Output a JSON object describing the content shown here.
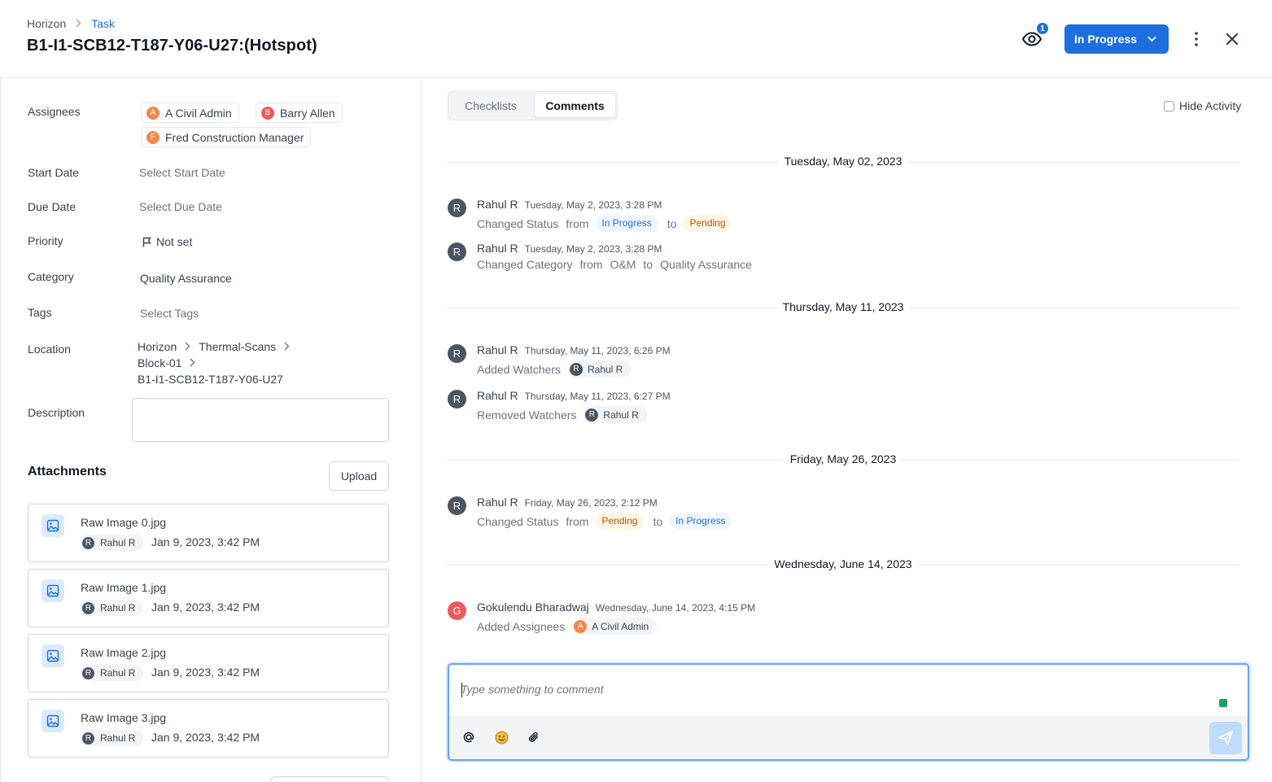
{
  "header": {
    "breadcrumb_root": "Horizon",
    "breadcrumb_current": "Task",
    "title": "B1-I1-SCB12-T187-Y06-U27:(Hotspot)",
    "watchers_count": "1",
    "status_label": "In Progress"
  },
  "details": {
    "assignees_label": "Assignees",
    "assignees": [
      {
        "initial": "A",
        "name": "A Civil Admin"
      },
      {
        "initial": "B",
        "name": "Barry Allen"
      },
      {
        "initial": "F",
        "name": "Fred Construction Manager"
      }
    ],
    "start_date_label": "Start Date",
    "start_date_placeholder": "Select Start Date",
    "due_date_label": "Due Date",
    "due_date_placeholder": "Select Due Date",
    "priority_label": "Priority",
    "priority_value": "Not set",
    "category_label": "Category",
    "category_value": "Quality Assurance",
    "tags_label": "Tags",
    "tags_placeholder": "Select Tags",
    "location_label": "Location",
    "location_path": [
      "Horizon",
      "Thermal-Scans",
      "Block-01",
      "B1-I1-SCB12-T187-Y06-U27"
    ],
    "description_label": "Description"
  },
  "attachments": {
    "title": "Attachments",
    "upload_label": "Upload",
    "items": [
      {
        "name": "Raw Image 0.jpg",
        "user_initial": "R",
        "user": "Rahul R",
        "date": "Jan 9, 2023, 3:42 PM"
      },
      {
        "name": "Raw Image 1.jpg",
        "user_initial": "R",
        "user": "Rahul R",
        "date": "Jan 9, 2023, 3:42 PM"
      },
      {
        "name": "Raw Image 2.jpg",
        "user_initial": "R",
        "user": "Rahul R",
        "date": "Jan 9, 2023, 3:42 PM"
      },
      {
        "name": "Raw Image 3.jpg",
        "user_initial": "R",
        "user": "Rahul R",
        "date": "Jan 9, 2023, 3:42 PM"
      }
    ]
  },
  "tabs": {
    "checklists": "Checklists",
    "comments": "Comments",
    "hide_activity": "Hide Activity"
  },
  "activity": {
    "day1": "Tuesday, May 02, 2023",
    "a1": {
      "initial": "R",
      "user": "Rahul R",
      "time": "Tuesday, May 2, 2023, 3:28 PM",
      "action": "Changed Status",
      "from_word": "from",
      "from": "In Progress",
      "to_word": "to",
      "to": "Pending"
    },
    "a2": {
      "initial": "R",
      "user": "Rahul R",
      "time": "Tuesday, May 2, 2023, 3:28 PM",
      "action": "Changed Category",
      "from_word": "from",
      "from": "O&M",
      "to_word": "to",
      "to": "Quality Assurance"
    },
    "day2": "Thursday, May 11, 2023",
    "a3": {
      "initial": "R",
      "user": "Rahul R",
      "time": "Thursday, May 11, 2023, 6:26 PM",
      "action": "Added Watchers",
      "target_initial": "R",
      "target": "Rahul R"
    },
    "a4": {
      "initial": "R",
      "user": "Rahul R",
      "time": "Thursday, May 11, 2023, 6:27 PM",
      "action": "Removed Watchers",
      "target_initial": "R",
      "target": "Rahul R"
    },
    "day3": "Friday, May 26, 2023",
    "a5": {
      "initial": "R",
      "user": "Rahul R",
      "time": "Friday, May 26, 2023, 2:12 PM",
      "action": "Changed Status",
      "from_word": "from",
      "from": "Pending",
      "to_word": "to",
      "to": "In Progress"
    },
    "day4": "Wednesday, June 14, 2023",
    "a6": {
      "initial": "G",
      "user": "Gokulendu Bharadwaj",
      "time": "Wednesday, June 14, 2023, 4:15 PM",
      "action": "Added Assignees",
      "target_initial": "A",
      "target": "A Civil Admin"
    }
  },
  "composer": {
    "placeholder": "Type something to comment"
  },
  "colors": {
    "accent": "#1d6fe0",
    "pending": "#b45309",
    "avatar_orange": "#f08a4b",
    "avatar_red": "#ef5a5a",
    "avatar_gray": "#4b5563"
  },
  "icons": {
    "watch": "eye-icon",
    "status": "chevron-down-icon",
    "more": "kebab-icon",
    "close": "close-icon",
    "priority": "flag-icon",
    "attachment": "image-icon",
    "mention": "at-icon",
    "emoji": "emoji-icon",
    "attach": "paperclip-icon",
    "send": "send-icon"
  }
}
